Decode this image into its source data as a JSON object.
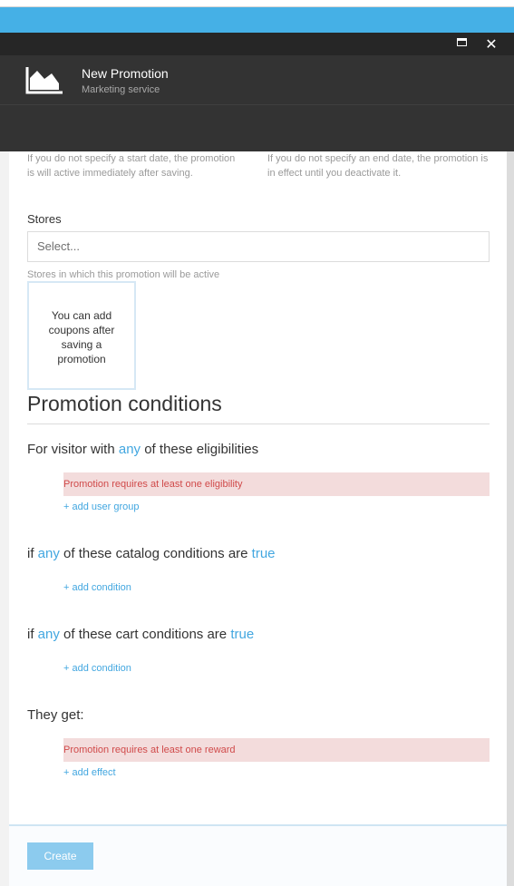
{
  "window": {
    "maximize_icon": "maximize-icon",
    "close_glyph": "✕"
  },
  "blade": {
    "title": "New Promotion",
    "subtitle": "Marketing service",
    "icon": "area-chart-icon"
  },
  "dates": {
    "start_hint": "If you do not specify a start date, the promotion is will active immediately after saving.",
    "end_hint": "If you do not specify an end date, the promotion is in effect until you deactivate it."
  },
  "stores": {
    "label": "Stores",
    "placeholder": "Select...",
    "hint": "Stores in which this promotion will be active"
  },
  "coupons": {
    "message": "You can add coupons after saving a promotion"
  },
  "conditions": {
    "title": "Promotion conditions",
    "visitor": {
      "prefix": "For visitor with",
      "any": "any",
      "suffix": "of these eligibilities",
      "error": "Promotion requires at least one eligibility",
      "add_link": "+ add user group"
    },
    "catalog": {
      "prefix": "if",
      "any": "any",
      "middle": "of these catalog conditions are",
      "truth": "true",
      "add_link": "+ add condition"
    },
    "cart": {
      "prefix": "if",
      "any": "any",
      "middle": "of these cart conditions are",
      "truth": "true",
      "add_link": "+ add condition"
    },
    "rewards": {
      "label": "They get:",
      "error": "Promotion requires at least one reward",
      "add_link": "+ add effect"
    }
  },
  "footer": {
    "create_label": "Create"
  }
}
